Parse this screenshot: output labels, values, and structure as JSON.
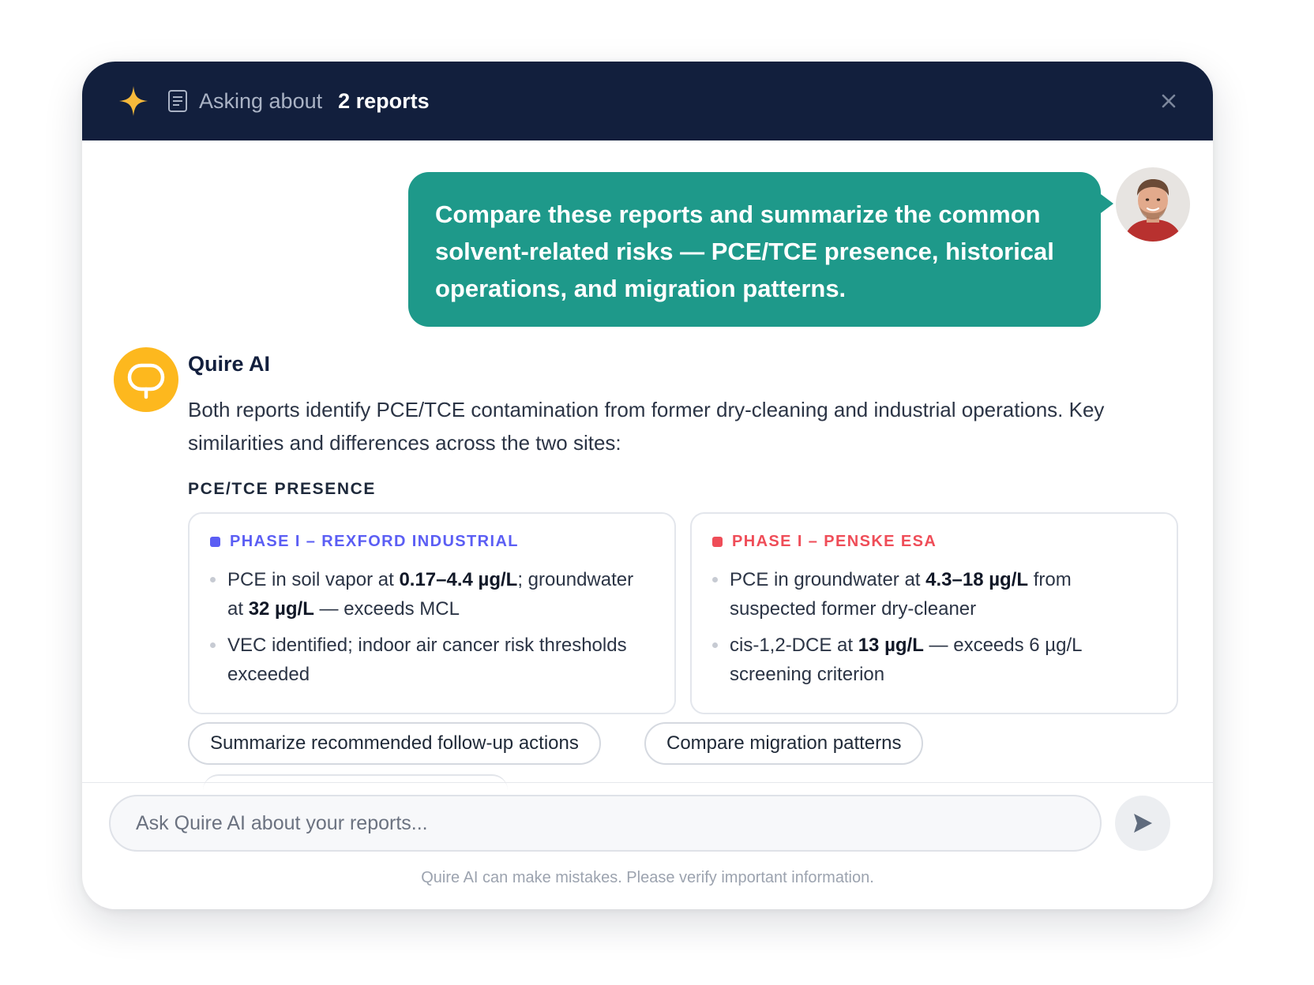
{
  "header": {
    "asking_label": "Asking about",
    "asking_count": "2 reports",
    "close_label": "×"
  },
  "user_message": {
    "text": "Compare these reports and summarize the common solvent-related risks — PCE/TCE presence, historical operations, and migration patterns."
  },
  "ai": {
    "name": "Quire AI",
    "intro": "Both reports identify PCE/TCE contamination from former dry-cleaning and industrial operations. Key similarities and differences across the two sites:",
    "section_heading": "PCE/TCE PRESENCE",
    "cards": [
      {
        "title": "PHASE I – REXFORD INDUSTRIAL",
        "accent": "#5b5ef4",
        "bullets": [
          {
            "pre": "PCE in soil vapor at ",
            "b1": "0.17–4.4 µg/L",
            "mid": "; groundwater at ",
            "b2": "32 µg/L",
            "post": " — exceeds MCL"
          },
          {
            "text": "VEC identified; indoor air cancer risk thresholds exceeded"
          }
        ]
      },
      {
        "title": "PHASE I – PENSKE ESA",
        "accent": "#ef4d58",
        "bullets": [
          {
            "pre": "PCE in groundwater at ",
            "b1": "4.3–18 µg/L",
            "post": " from suspected former dry-cleaner"
          },
          {
            "pre": "cis-1,2-DCE at ",
            "b1": "13 µg/L",
            "post": " — exceeds 6 µg/L screening criterion"
          }
        ]
      }
    ]
  },
  "suggestions": [
    "Summarize recommended follow-up actions",
    "Compare migration patterns"
  ],
  "composer": {
    "placeholder": "Ask Quire AI about your reports..."
  },
  "disclaimer": "Quire AI can make mistakes. Please verify important information.",
  "colors": {
    "header_bg": "#121f3d",
    "user_bubble": "#1e998a",
    "ai_avatar": "#fdb81e",
    "spark": "#f6b93b"
  }
}
